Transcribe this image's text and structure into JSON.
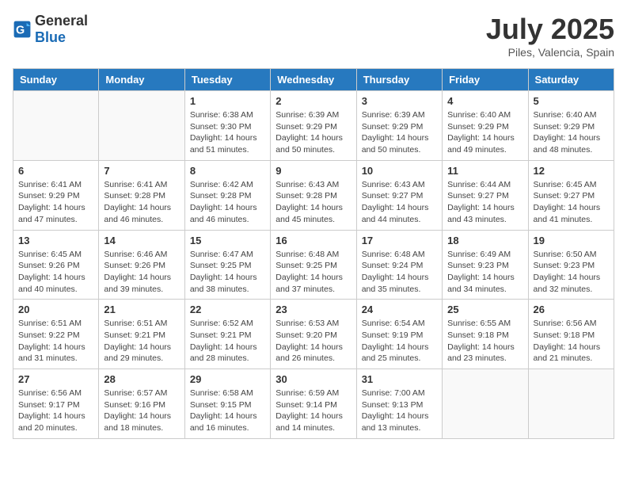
{
  "header": {
    "logo_general": "General",
    "logo_blue": "Blue",
    "month_year": "July 2025",
    "location": "Piles, Valencia, Spain"
  },
  "weekdays": [
    "Sunday",
    "Monday",
    "Tuesday",
    "Wednesday",
    "Thursday",
    "Friday",
    "Saturday"
  ],
  "weeks": [
    [
      {
        "day": "",
        "sunrise": "",
        "sunset": "",
        "daylight": ""
      },
      {
        "day": "",
        "sunrise": "",
        "sunset": "",
        "daylight": ""
      },
      {
        "day": "1",
        "sunrise": "Sunrise: 6:38 AM",
        "sunset": "Sunset: 9:30 PM",
        "daylight": "Daylight: 14 hours and 51 minutes."
      },
      {
        "day": "2",
        "sunrise": "Sunrise: 6:39 AM",
        "sunset": "Sunset: 9:29 PM",
        "daylight": "Daylight: 14 hours and 50 minutes."
      },
      {
        "day": "3",
        "sunrise": "Sunrise: 6:39 AM",
        "sunset": "Sunset: 9:29 PM",
        "daylight": "Daylight: 14 hours and 50 minutes."
      },
      {
        "day": "4",
        "sunrise": "Sunrise: 6:40 AM",
        "sunset": "Sunset: 9:29 PM",
        "daylight": "Daylight: 14 hours and 49 minutes."
      },
      {
        "day": "5",
        "sunrise": "Sunrise: 6:40 AM",
        "sunset": "Sunset: 9:29 PM",
        "daylight": "Daylight: 14 hours and 48 minutes."
      }
    ],
    [
      {
        "day": "6",
        "sunrise": "Sunrise: 6:41 AM",
        "sunset": "Sunset: 9:29 PM",
        "daylight": "Daylight: 14 hours and 47 minutes."
      },
      {
        "day": "7",
        "sunrise": "Sunrise: 6:41 AM",
        "sunset": "Sunset: 9:28 PM",
        "daylight": "Daylight: 14 hours and 46 minutes."
      },
      {
        "day": "8",
        "sunrise": "Sunrise: 6:42 AM",
        "sunset": "Sunset: 9:28 PM",
        "daylight": "Daylight: 14 hours and 46 minutes."
      },
      {
        "day": "9",
        "sunrise": "Sunrise: 6:43 AM",
        "sunset": "Sunset: 9:28 PM",
        "daylight": "Daylight: 14 hours and 45 minutes."
      },
      {
        "day": "10",
        "sunrise": "Sunrise: 6:43 AM",
        "sunset": "Sunset: 9:27 PM",
        "daylight": "Daylight: 14 hours and 44 minutes."
      },
      {
        "day": "11",
        "sunrise": "Sunrise: 6:44 AM",
        "sunset": "Sunset: 9:27 PM",
        "daylight": "Daylight: 14 hours and 43 minutes."
      },
      {
        "day": "12",
        "sunrise": "Sunrise: 6:45 AM",
        "sunset": "Sunset: 9:27 PM",
        "daylight": "Daylight: 14 hours and 41 minutes."
      }
    ],
    [
      {
        "day": "13",
        "sunrise": "Sunrise: 6:45 AM",
        "sunset": "Sunset: 9:26 PM",
        "daylight": "Daylight: 14 hours and 40 minutes."
      },
      {
        "day": "14",
        "sunrise": "Sunrise: 6:46 AM",
        "sunset": "Sunset: 9:26 PM",
        "daylight": "Daylight: 14 hours and 39 minutes."
      },
      {
        "day": "15",
        "sunrise": "Sunrise: 6:47 AM",
        "sunset": "Sunset: 9:25 PM",
        "daylight": "Daylight: 14 hours and 38 minutes."
      },
      {
        "day": "16",
        "sunrise": "Sunrise: 6:48 AM",
        "sunset": "Sunset: 9:25 PM",
        "daylight": "Daylight: 14 hours and 37 minutes."
      },
      {
        "day": "17",
        "sunrise": "Sunrise: 6:48 AM",
        "sunset": "Sunset: 9:24 PM",
        "daylight": "Daylight: 14 hours and 35 minutes."
      },
      {
        "day": "18",
        "sunrise": "Sunrise: 6:49 AM",
        "sunset": "Sunset: 9:23 PM",
        "daylight": "Daylight: 14 hours and 34 minutes."
      },
      {
        "day": "19",
        "sunrise": "Sunrise: 6:50 AM",
        "sunset": "Sunset: 9:23 PM",
        "daylight": "Daylight: 14 hours and 32 minutes."
      }
    ],
    [
      {
        "day": "20",
        "sunrise": "Sunrise: 6:51 AM",
        "sunset": "Sunset: 9:22 PM",
        "daylight": "Daylight: 14 hours and 31 minutes."
      },
      {
        "day": "21",
        "sunrise": "Sunrise: 6:51 AM",
        "sunset": "Sunset: 9:21 PM",
        "daylight": "Daylight: 14 hours and 29 minutes."
      },
      {
        "day": "22",
        "sunrise": "Sunrise: 6:52 AM",
        "sunset": "Sunset: 9:21 PM",
        "daylight": "Daylight: 14 hours and 28 minutes."
      },
      {
        "day": "23",
        "sunrise": "Sunrise: 6:53 AM",
        "sunset": "Sunset: 9:20 PM",
        "daylight": "Daylight: 14 hours and 26 minutes."
      },
      {
        "day": "24",
        "sunrise": "Sunrise: 6:54 AM",
        "sunset": "Sunset: 9:19 PM",
        "daylight": "Daylight: 14 hours and 25 minutes."
      },
      {
        "day": "25",
        "sunrise": "Sunrise: 6:55 AM",
        "sunset": "Sunset: 9:18 PM",
        "daylight": "Daylight: 14 hours and 23 minutes."
      },
      {
        "day": "26",
        "sunrise": "Sunrise: 6:56 AM",
        "sunset": "Sunset: 9:18 PM",
        "daylight": "Daylight: 14 hours and 21 minutes."
      }
    ],
    [
      {
        "day": "27",
        "sunrise": "Sunrise: 6:56 AM",
        "sunset": "Sunset: 9:17 PM",
        "daylight": "Daylight: 14 hours and 20 minutes."
      },
      {
        "day": "28",
        "sunrise": "Sunrise: 6:57 AM",
        "sunset": "Sunset: 9:16 PM",
        "daylight": "Daylight: 14 hours and 18 minutes."
      },
      {
        "day": "29",
        "sunrise": "Sunrise: 6:58 AM",
        "sunset": "Sunset: 9:15 PM",
        "daylight": "Daylight: 14 hours and 16 minutes."
      },
      {
        "day": "30",
        "sunrise": "Sunrise: 6:59 AM",
        "sunset": "Sunset: 9:14 PM",
        "daylight": "Daylight: 14 hours and 14 minutes."
      },
      {
        "day": "31",
        "sunrise": "Sunrise: 7:00 AM",
        "sunset": "Sunset: 9:13 PM",
        "daylight": "Daylight: 14 hours and 13 minutes."
      },
      {
        "day": "",
        "sunrise": "",
        "sunset": "",
        "daylight": ""
      },
      {
        "day": "",
        "sunrise": "",
        "sunset": "",
        "daylight": ""
      }
    ]
  ]
}
